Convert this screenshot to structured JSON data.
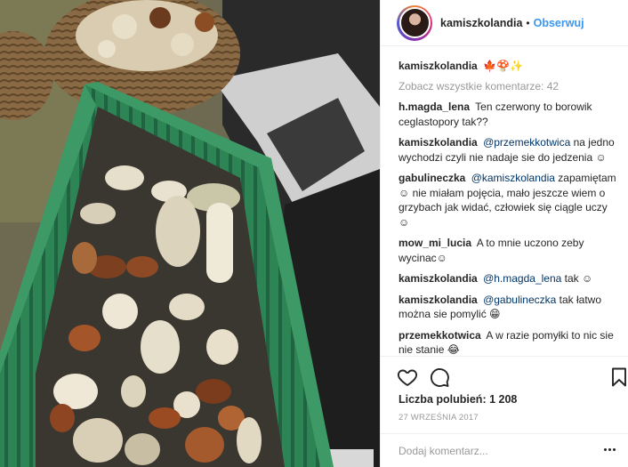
{
  "post": {
    "username": "kamiszkolandia",
    "dot": "•",
    "follow_label": "Obserwuj",
    "avatar_icon": "profile-photo"
  },
  "caption": {
    "username": "kamiszkolandia",
    "text": "🍁🍄✨"
  },
  "view_all_comments": "Zobacz wszystkie komentarze: 42",
  "comments": [
    {
      "user": "h.magda_lena",
      "mention": "",
      "text": "Ten czerwony to borowik ceglastopory tak??"
    },
    {
      "user": "kamiszkolandia",
      "mention": "@przemekkotwica",
      "text": "na jedno wychodzi czyli nie nadaje sie do jedzenia ☺"
    },
    {
      "user": "gabulineczka",
      "mention": "@kamiszkolandia",
      "text": "zapamiętam ☺ nie miałam pojęcia, mało jeszcze wiem o grzybach jak widać, człowiek się ciągle uczy ☺"
    },
    {
      "user": "mow_mi_lucia",
      "mention": "",
      "text": "A to mnie uczono zeby wycinac☺"
    },
    {
      "user": "kamiszkolandia",
      "mention": "@h.magda_lena",
      "text": "tak ☺"
    },
    {
      "user": "kamiszkolandia",
      "mention": "@gabulineczka",
      "text": "tak łatwo można sie pomylić 😁"
    },
    {
      "user": "przemekkotwica",
      "mention": "",
      "text": "A w razie pomyłki to nic sie nie stanie 😂"
    }
  ],
  "actions": {
    "like_icon": "heart-outline-icon",
    "comment_icon": "comment-bubble-icon",
    "save_icon": "bookmark-icon"
  },
  "likes_text": "Liczba polubień: 1 208",
  "date_text": "27 WRZEŚNIA 2017",
  "add_comment": {
    "placeholder": "Dodaj komentarz...",
    "more_icon": "ellipsis-icon"
  },
  "colors": {
    "link_blue": "#3897f0",
    "mention_blue": "#003569",
    "crate_green": "#2f8a5a",
    "muted_text": "#999999"
  }
}
